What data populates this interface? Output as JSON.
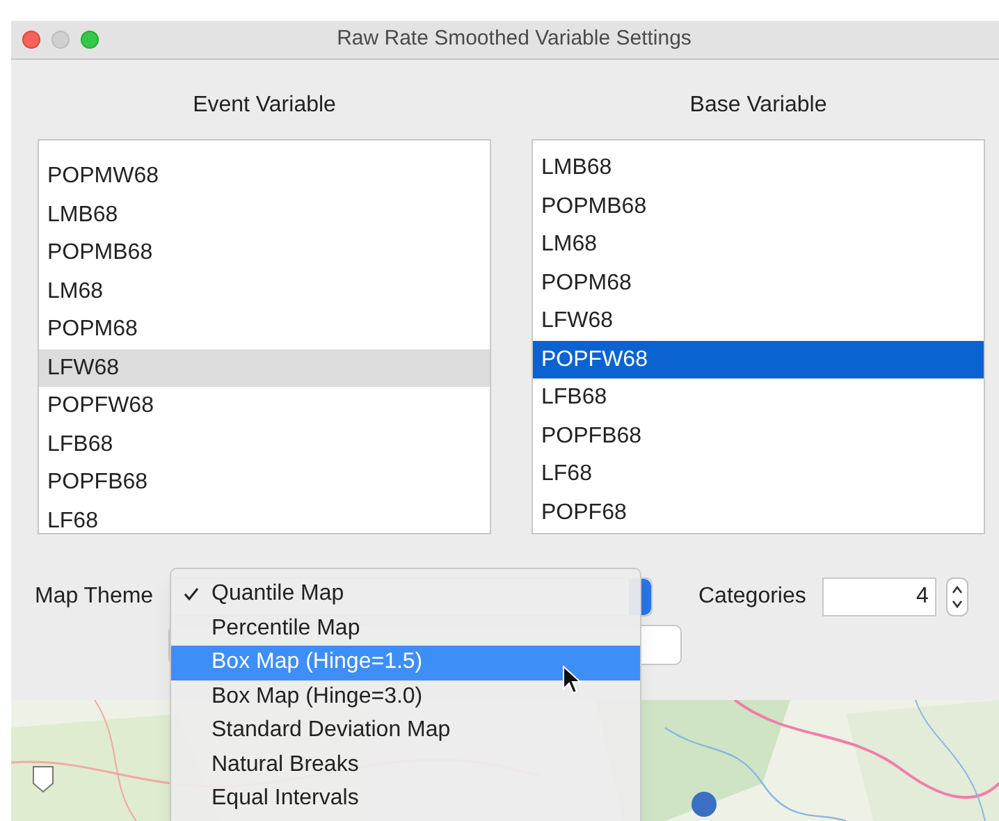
{
  "window": {
    "title": "Raw Rate Smoothed Variable Settings"
  },
  "event_variable": {
    "label": "Event Variable",
    "focused": false,
    "items": [
      {
        "label": "POPMW68",
        "selected": false
      },
      {
        "label": "LMB68",
        "selected": false
      },
      {
        "label": "POPMB68",
        "selected": false
      },
      {
        "label": "LM68",
        "selected": false
      },
      {
        "label": "POPM68",
        "selected": false
      },
      {
        "label": "LFW68",
        "selected": true
      },
      {
        "label": "POPFW68",
        "selected": false
      },
      {
        "label": "LFB68",
        "selected": false
      },
      {
        "label": "POPFB68",
        "selected": false
      },
      {
        "label": "LF68",
        "selected": false
      }
    ]
  },
  "base_variable": {
    "label": "Base Variable",
    "focused": true,
    "items": [
      {
        "label": "LMB68",
        "selected": false
      },
      {
        "label": "POPMB68",
        "selected": false
      },
      {
        "label": "LM68",
        "selected": false
      },
      {
        "label": "POPM68",
        "selected": false
      },
      {
        "label": "LFW68",
        "selected": false
      },
      {
        "label": "POPFW68",
        "selected": true
      },
      {
        "label": "LFB68",
        "selected": false
      },
      {
        "label": "POPFB68",
        "selected": false
      },
      {
        "label": "LF68",
        "selected": false
      },
      {
        "label": "POPF68",
        "selected": false
      }
    ]
  },
  "map_theme": {
    "label": "Map Theme",
    "menu": [
      {
        "label": "Quantile Map",
        "checked": true,
        "selected": false
      },
      {
        "label": "Percentile Map",
        "checked": false,
        "selected": false
      },
      {
        "label": "Box Map (Hinge=1.5)",
        "checked": false,
        "selected": true
      },
      {
        "label": "Box Map (Hinge=3.0)",
        "checked": false,
        "selected": false
      },
      {
        "label": "Standard Deviation Map",
        "checked": false,
        "selected": false
      },
      {
        "label": "Natural Breaks",
        "checked": false,
        "selected": false
      },
      {
        "label": "Equal Intervals",
        "checked": false,
        "selected": false
      }
    ]
  },
  "categories": {
    "label": "Categories",
    "value": "4"
  }
}
